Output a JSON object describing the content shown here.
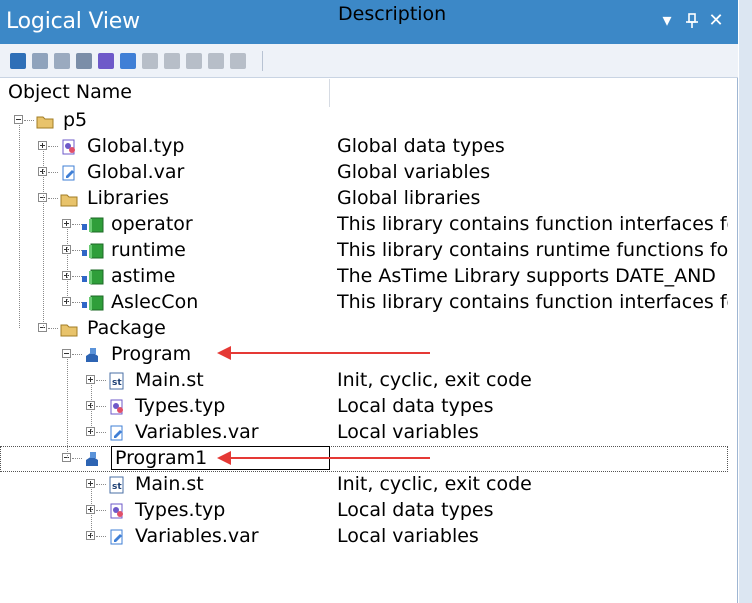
{
  "panel": {
    "title": "Logical View"
  },
  "titlebar_buttons": [
    {
      "icon": "dropdown-icon",
      "glyph": "▾"
    },
    {
      "icon": "pin-icon",
      "glyph": "⊥"
    },
    {
      "icon": "close-icon",
      "glyph": "✕"
    }
  ],
  "toolbar": {
    "tools": [
      {
        "icon": "object-icon",
        "color": "#2e6fb7"
      },
      {
        "icon": "properties-icon",
        "color": "#8fa3bc"
      },
      {
        "icon": "grid-icon",
        "color": "#9aaabf"
      },
      {
        "icon": "file-icon",
        "color": "#7b8ea8"
      },
      {
        "icon": "datatype-icon",
        "color": "#6e59c9"
      },
      {
        "icon": "variable-icon",
        "color": "#3f7fd6"
      },
      {
        "icon": "disabled-tool-1-icon",
        "color": "#b7bec8"
      },
      {
        "icon": "disabled-tool-2-icon",
        "color": "#b7bec8"
      },
      {
        "icon": "disabled-tool-3-icon",
        "color": "#b7bec8"
      },
      {
        "icon": "disabled-tool-4-icon",
        "color": "#b7bec8"
      },
      {
        "icon": "disabled-tool-5-icon",
        "color": "#b7bec8"
      }
    ]
  },
  "columns": {
    "name": "Object Name",
    "description": "Description"
  },
  "tree": [
    {
      "label": "p5",
      "desc": "",
      "icon": "folder-icon",
      "level": 0,
      "expander": "minus"
    },
    {
      "label": "Global.typ",
      "desc": "Global data types",
      "icon": "datatype-file-icon",
      "level": 1,
      "expander": "plus"
    },
    {
      "label": "Global.var",
      "desc": "Global variables",
      "icon": "variable-file-icon",
      "level": 1,
      "expander": "plus"
    },
    {
      "label": "Libraries",
      "desc": "Global libraries",
      "icon": "folder-icon",
      "level": 1,
      "expander": "minus"
    },
    {
      "label": "operator",
      "desc": "This library contains function interfaces fo",
      "icon": "library-icon",
      "level": 2,
      "expander": "plus"
    },
    {
      "label": "runtime",
      "desc": "This library contains runtime functions for",
      "icon": "library-icon",
      "level": 2,
      "expander": "plus"
    },
    {
      "label": "astime",
      "desc": "The AsTime Library supports DATE_AND",
      "icon": "library-icon",
      "level": 2,
      "expander": "plus"
    },
    {
      "label": "AslecCon",
      "desc": "This library contains function interfaces fo",
      "icon": "library-icon",
      "level": 2,
      "expander": "plus"
    },
    {
      "label": "Package",
      "desc": "",
      "icon": "folder-icon",
      "level": 1,
      "expander": "minus"
    },
    {
      "label": "Program",
      "desc": "",
      "icon": "program-icon",
      "level": 2,
      "expander": "minus"
    },
    {
      "label": "Main.st",
      "desc": "Init, cyclic, exit code",
      "icon": "st-file-icon",
      "level": 3,
      "expander": "plus"
    },
    {
      "label": "Types.typ",
      "desc": "Local data types",
      "icon": "datatype-file-icon",
      "level": 3,
      "expander": "plus"
    },
    {
      "label": "Variables.var",
      "desc": "Local variables",
      "icon": "variable-file-icon",
      "level": 3,
      "expander": "plus"
    },
    {
      "label": "Program1",
      "desc": "",
      "icon": "program-icon",
      "level": 2,
      "expander": "minus",
      "editing": true
    },
    {
      "label": "Main.st",
      "desc": "Init, cyclic, exit code",
      "icon": "st-file-icon",
      "level": 3,
      "expander": "plus"
    },
    {
      "label": "Types.typ",
      "desc": "Local data types",
      "icon": "datatype-file-icon",
      "level": 3,
      "expander": "plus"
    },
    {
      "label": "Variables.var",
      "desc": "Local variables",
      "icon": "variable-file-icon",
      "level": 3,
      "expander": "plus"
    }
  ],
  "colors": {
    "titlebar": "#3c88c7",
    "annotation_arrow": "#e53935",
    "folder": "#e8c36b",
    "library": "#2f9e3a",
    "program": "#2d64b3"
  }
}
